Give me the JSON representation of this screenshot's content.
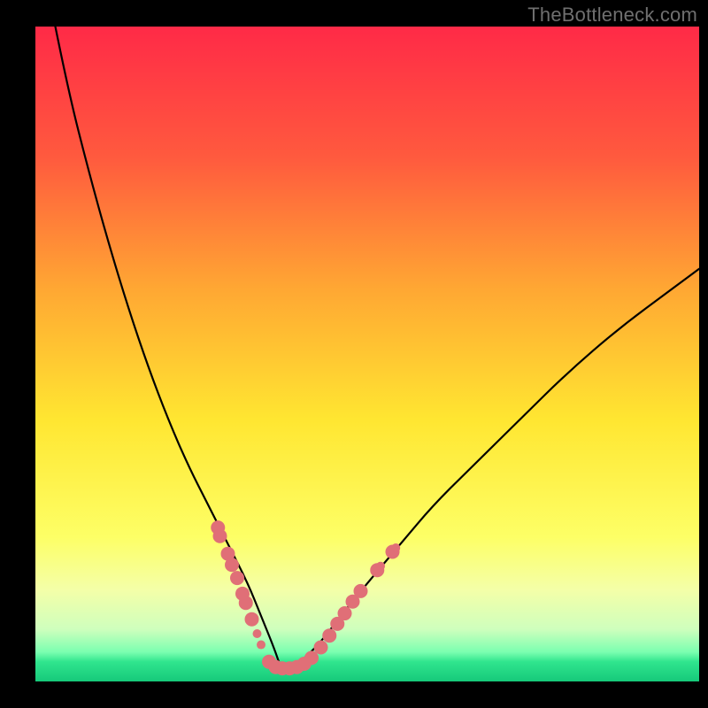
{
  "watermark": "TheBottleneck.com",
  "chart_data": {
    "type": "line",
    "title": "",
    "xlabel": "",
    "ylabel": "",
    "xlim": [
      0,
      100
    ],
    "ylim": [
      0,
      100
    ],
    "grid": false,
    "legend": false,
    "background_gradient": [
      {
        "offset": 0.0,
        "color": "#ff2a47"
      },
      {
        "offset": 0.2,
        "color": "#ff5a3e"
      },
      {
        "offset": 0.4,
        "color": "#ffa733"
      },
      {
        "offset": 0.6,
        "color": "#ffe631"
      },
      {
        "offset": 0.78,
        "color": "#fdff66"
      },
      {
        "offset": 0.86,
        "color": "#f4ffa8"
      },
      {
        "offset": 0.92,
        "color": "#cfffbd"
      },
      {
        "offset": 0.955,
        "color": "#7bffb0"
      },
      {
        "offset": 0.97,
        "color": "#30e58e"
      },
      {
        "offset": 1.0,
        "color": "#16c97a"
      }
    ],
    "bottleneck_minimum_x": 37,
    "series": [
      {
        "name": "bottleneck-curve",
        "x": [
          3,
          5,
          8,
          11,
          14,
          17,
          20,
          23,
          26,
          29,
          32,
          34,
          36,
          37,
          38,
          40,
          43,
          46,
          50,
          55,
          60,
          66,
          73,
          80,
          88,
          96,
          100
        ],
        "y": [
          100,
          90,
          78,
          67,
          57,
          48,
          40,
          33,
          27,
          21,
          15,
          10,
          5,
          2,
          2,
          3,
          6,
          10,
          15,
          21,
          27,
          33,
          40,
          47,
          54,
          60,
          63
        ]
      }
    ],
    "marker_points": {
      "name": "bottleneck-markers",
      "color": "#e06f77",
      "radius_main": 8,
      "radius_small": 5,
      "points": [
        {
          "x": 27.5,
          "y": 23.5
        },
        {
          "x": 27.8,
          "y": 22.2
        },
        {
          "x": 29.0,
          "y": 19.5
        },
        {
          "x": 29.6,
          "y": 17.8
        },
        {
          "x": 30.4,
          "y": 15.8
        },
        {
          "x": 31.2,
          "y": 13.4
        },
        {
          "x": 31.7,
          "y": 12.0
        },
        {
          "x": 32.6,
          "y": 9.5
        },
        {
          "x": 33.4,
          "y": 7.3,
          "small": true
        },
        {
          "x": 34.0,
          "y": 5.6,
          "small": true
        },
        {
          "x": 35.2,
          "y": 3.0
        },
        {
          "x": 36.2,
          "y": 2.2
        },
        {
          "x": 37.2,
          "y": 2.0
        },
        {
          "x": 38.3,
          "y": 2.0
        },
        {
          "x": 39.4,
          "y": 2.2
        },
        {
          "x": 40.5,
          "y": 2.7
        },
        {
          "x": 41.6,
          "y": 3.6
        },
        {
          "x": 43.0,
          "y": 5.2
        },
        {
          "x": 44.3,
          "y": 7.0
        },
        {
          "x": 45.5,
          "y": 8.8
        },
        {
          "x": 46.6,
          "y": 10.4
        },
        {
          "x": 47.8,
          "y": 12.2
        },
        {
          "x": 49.0,
          "y": 13.8
        },
        {
          "x": 51.5,
          "y": 17.0
        },
        {
          "x": 52.0,
          "y": 17.6,
          "small": true
        },
        {
          "x": 53.8,
          "y": 19.8
        },
        {
          "x": 54.3,
          "y": 20.4,
          "small": true
        }
      ]
    }
  }
}
